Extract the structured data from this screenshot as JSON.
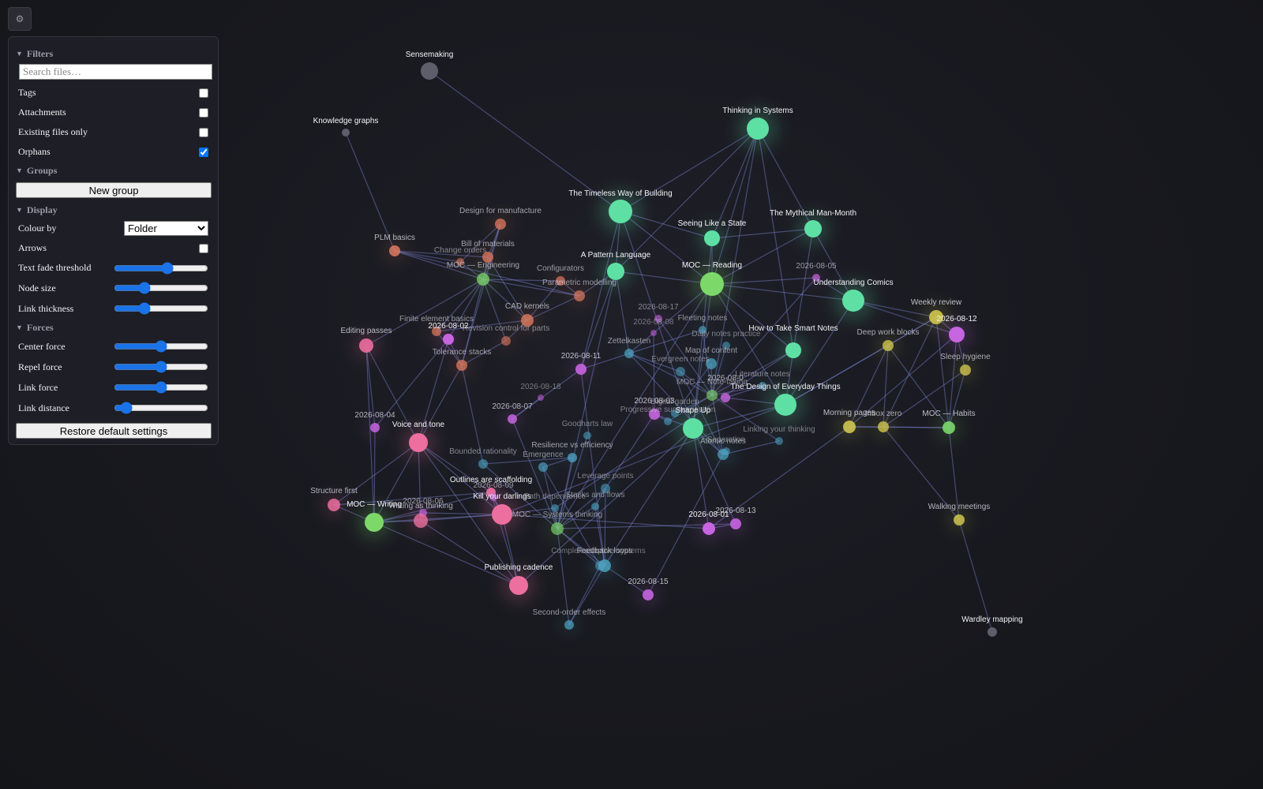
{
  "toolbar": {
    "settings_icon": "gear-icon",
    "settings_glyph": "⚙"
  },
  "settings": {
    "filters": {
      "title": "Filters",
      "search_placeholder": "Search files…",
      "search_value": "",
      "toggles": [
        {
          "label": "Tags",
          "checked": false
        },
        {
          "label": "Attachments",
          "checked": false
        },
        {
          "label": "Existing files only",
          "checked": false
        },
        {
          "label": "Orphans",
          "checked": true
        }
      ]
    },
    "groups": {
      "title": "Groups",
      "new_group_label": "New group"
    },
    "display": {
      "title": "Display",
      "colour_by_label": "Colour by",
      "colour_by_value": "Folder",
      "arrows_label": "Arrows",
      "arrows_checked": false,
      "sliders": [
        {
          "label": "Text fade threshold",
          "value": 0.58
        },
        {
          "label": "Node size",
          "value": 0.3
        },
        {
          "label": "Link thickness",
          "value": 0.3
        }
      ]
    },
    "forces": {
      "title": "Forces",
      "sliders": [
        {
          "label": "Center force",
          "value": 0.5
        },
        {
          "label": "Repel force",
          "value": 0.5
        },
        {
          "label": "Link force",
          "value": 0.5
        },
        {
          "label": "Link distance",
          "value": 0.08
        }
      ]
    },
    "restore_label": "Restore default settings"
  },
  "graph": {
    "colors": {
      "reading": "#5ee0a4",
      "moc": "#7dd86a",
      "writing": "#ec6f9f",
      "engineering": "#e07a5f",
      "daily": "#c765e0",
      "habits": "#cfc64e",
      "systems": "#4fa6c6",
      "unresolved": "#5d5e6a"
    },
    "nodes": [
      {
        "id": "sense",
        "label": "Sensemaking",
        "group": "unresolved"
      },
      {
        "id": "kg",
        "label": "Knowledge graphs",
        "group": "unresolved"
      },
      {
        "id": "tis",
        "label": "Thinking in Systems",
        "group": "reading"
      },
      {
        "id": "twb",
        "label": "The Timeless Way of Building",
        "group": "reading"
      },
      {
        "id": "sls",
        "label": "Seeing Like a State",
        "group": "reading"
      },
      {
        "id": "tmm",
        "label": "The Mythical Man-Month",
        "group": "reading"
      },
      {
        "id": "apl",
        "label": "A Pattern Language",
        "group": "reading"
      },
      {
        "id": "mocr",
        "label": "MOC — Reading",
        "group": "moc"
      },
      {
        "id": "uc",
        "label": "Understanding Comics",
        "group": "reading"
      },
      {
        "id": "htsn",
        "label": "How to Take Smart Notes",
        "group": "reading"
      },
      {
        "id": "tdet",
        "label": "The Design of Everyday Things",
        "group": "reading"
      },
      {
        "id": "su",
        "label": "Shape Up",
        "group": "reading"
      },
      {
        "id": "dfm",
        "label": "Design for manufacture",
        "group": "engineering"
      },
      {
        "id": "plm",
        "label": "PLM basics",
        "group": "engineering"
      },
      {
        "id": "bom",
        "label": "Bill of materials",
        "group": "engineering"
      },
      {
        "id": "co",
        "label": "Change orders",
        "group": "engineering"
      },
      {
        "id": "moce",
        "label": "MOC — Engineering",
        "group": "moc"
      },
      {
        "id": "conf",
        "label": "Configurators",
        "group": "engineering"
      },
      {
        "id": "pm",
        "label": "Parametric modelling",
        "group": "engineering"
      },
      {
        "id": "cad",
        "label": "CAD kernels",
        "group": "engineering"
      },
      {
        "id": "fea",
        "label": "Finite element basics",
        "group": "engineering"
      },
      {
        "id": "rcp",
        "label": "Revision control for parts",
        "group": "engineering"
      },
      {
        "id": "tol",
        "label": "Tolerance stacks",
        "group": "engineering"
      },
      {
        "id": "d0802",
        "label": "2026-08-02",
        "group": "daily"
      },
      {
        "id": "ep",
        "label": "Editing passes",
        "group": "writing"
      },
      {
        "id": "d0805",
        "label": "2026-08-05",
        "group": "daily"
      },
      {
        "id": "d0817",
        "label": "2026-08-17",
        "group": "daily"
      },
      {
        "id": "d0808",
        "label": "2026-08-08",
        "group": "daily"
      },
      {
        "id": "wr",
        "label": "Weekly review",
        "group": "habits"
      },
      {
        "id": "d0812",
        "label": "2026-08-12",
        "group": "daily"
      },
      {
        "id": "dwb",
        "label": "Deep work blocks",
        "group": "habits"
      },
      {
        "id": "sh",
        "label": "Sleep hygiene",
        "group": "habits"
      },
      {
        "id": "fn",
        "label": "Fleeting notes",
        "group": "systems"
      },
      {
        "id": "dnp",
        "label": "Daily notes practice",
        "group": "systems"
      },
      {
        "id": "zk",
        "label": "Zettelkasten",
        "group": "systems"
      },
      {
        "id": "mapc",
        "label": "Map of content",
        "group": "systems"
      },
      {
        "id": "en",
        "label": "Evergreen notes",
        "group": "systems"
      },
      {
        "id": "d0811",
        "label": "2026-08-11",
        "group": "daily"
      },
      {
        "id": "d0818",
        "label": "2026-08-18",
        "group": "daily"
      },
      {
        "id": "ln",
        "label": "Literature notes",
        "group": "systems"
      },
      {
        "id": "mocnt",
        "label": "MOC — Note-taking",
        "group": "moc"
      },
      {
        "id": "d0807b",
        "label": "2026-08-0",
        "group": "daily"
      },
      {
        "id": "dg",
        "label": "Digital garden",
        "group": "systems"
      },
      {
        "id": "d0803",
        "label": "2026-08-03",
        "group": "daily"
      },
      {
        "id": "ps",
        "label": "Progressive summarisation",
        "group": "systems"
      },
      {
        "id": "d0804",
        "label": "2026-08-04",
        "group": "daily"
      },
      {
        "id": "vt",
        "label": "Voice and tone",
        "group": "writing"
      },
      {
        "id": "d0807",
        "label": "2026-08-07",
        "group": "daily"
      },
      {
        "id": "gl",
        "label": "Goodharts law",
        "group": "systems"
      },
      {
        "id": "mp",
        "label": "Morning pages",
        "group": "habits"
      },
      {
        "id": "iz",
        "label": "Inbox zero",
        "group": "habits"
      },
      {
        "id": "moch",
        "label": "MOC — Habits",
        "group": "moc"
      },
      {
        "id": "sep",
        "label": "Separation",
        "group": "systems"
      },
      {
        "id": "an",
        "label": "Atomic notes",
        "group": "systems"
      },
      {
        "id": "lyt",
        "label": "Linking your thinking",
        "group": "systems"
      },
      {
        "id": "br",
        "label": "Bounded rationality",
        "group": "systems"
      },
      {
        "id": "rve",
        "label": "Resilience vs efficiency",
        "group": "systems"
      },
      {
        "id": "emg",
        "label": "Emergence",
        "group": "systems"
      },
      {
        "id": "lp",
        "label": "Leverage points",
        "group": "systems"
      },
      {
        "id": "sf",
        "label": "Structure first",
        "group": "writing"
      },
      {
        "id": "mocw",
        "label": "MOC — Writing",
        "group": "moc"
      },
      {
        "id": "d0806",
        "label": "2026-08-06",
        "group": "daily"
      },
      {
        "id": "wat",
        "label": "Writing as thinking",
        "group": "writing"
      },
      {
        "id": "oas",
        "label": "Outlines are scaffolding",
        "group": "writing"
      },
      {
        "id": "d0809",
        "label": "2026-08-09",
        "group": "daily"
      },
      {
        "id": "kyd",
        "label": "Kill your darlings",
        "group": "writing"
      },
      {
        "id": "pd",
        "label": "Path dependence",
        "group": "systems"
      },
      {
        "id": "saf",
        "label": "Stocks and flows",
        "group": "systems"
      },
      {
        "id": "mocst",
        "label": "MOC — Systems thinking",
        "group": "moc"
      },
      {
        "id": "d0801",
        "label": "2026-08-01",
        "group": "daily"
      },
      {
        "id": "d0813",
        "label": "2026-08-13",
        "group": "daily"
      },
      {
        "id": "wm",
        "label": "Walking meetings",
        "group": "habits"
      },
      {
        "id": "cas",
        "label": "Complex adaptive systems",
        "group": "systems"
      },
      {
        "id": "fl",
        "label": "Feedback loops",
        "group": "systems"
      },
      {
        "id": "pc",
        "label": "Publishing cadence",
        "group": "writing"
      },
      {
        "id": "d0815",
        "label": "2026-08-15",
        "group": "daily"
      },
      {
        "id": "soe",
        "label": "Second-order effects",
        "group": "systems"
      },
      {
        "id": "ward",
        "label": "Wardley mapping",
        "group": "unresolved"
      }
    ],
    "links": [
      [
        "sense",
        "twb"
      ],
      [
        "kg",
        "plm"
      ],
      [
        "tis",
        "twb"
      ],
      [
        "tis",
        "tmm"
      ],
      [
        "tis",
        "sls"
      ],
      [
        "tis",
        "apl"
      ],
      [
        "tis",
        "htsn"
      ],
      [
        "tis",
        "mocr"
      ],
      [
        "twb",
        "apl"
      ],
      [
        "twb",
        "mocr"
      ],
      [
        "twb",
        "sls"
      ],
      [
        "twb",
        "su"
      ],
      [
        "sls",
        "tmm"
      ],
      [
        "sls",
        "mocr"
      ],
      [
        "tmm",
        "uc"
      ],
      [
        "tmm",
        "mocr"
      ],
      [
        "tmm",
        "htsn"
      ],
      [
        "mocr",
        "uc"
      ],
      [
        "mocr",
        "htsn"
      ],
      [
        "mocr",
        "tdet"
      ],
      [
        "mocr",
        "su"
      ],
      [
        "mocr",
        "apl"
      ],
      [
        "mocr",
        "zk"
      ],
      [
        "mocr",
        "d0805"
      ],
      [
        "uc",
        "d0812"
      ],
      [
        "uc",
        "wr"
      ],
      [
        "uc",
        "tdet"
      ],
      [
        "htsn",
        "mocnt"
      ],
      [
        "htsn",
        "tdet"
      ],
      [
        "tdet",
        "su"
      ],
      [
        "tdet",
        "d0807b"
      ],
      [
        "tdet",
        "dwb"
      ],
      [
        "su",
        "d0803"
      ],
      [
        "su",
        "an"
      ],
      [
        "su",
        "d0801"
      ],
      [
        "su",
        "d0813"
      ],
      [
        "apl",
        "zk"
      ],
      [
        "apl",
        "d0811"
      ],
      [
        "apl",
        "pm"
      ],
      [
        "dfm",
        "moce"
      ],
      [
        "dfm",
        "bom"
      ],
      [
        "dfm",
        "co"
      ],
      [
        "plm",
        "moce"
      ],
      [
        "plm",
        "bom"
      ],
      [
        "plm",
        "co"
      ],
      [
        "plm",
        "pm"
      ],
      [
        "bom",
        "moce"
      ],
      [
        "co",
        "moce"
      ],
      [
        "moce",
        "conf"
      ],
      [
        "moce",
        "pm"
      ],
      [
        "moce",
        "cad"
      ],
      [
        "moce",
        "fea"
      ],
      [
        "moce",
        "rcp"
      ],
      [
        "moce",
        "tol"
      ],
      [
        "moce",
        "d0802"
      ],
      [
        "moce",
        "ep"
      ],
      [
        "conf",
        "pm"
      ],
      [
        "conf",
        "cad"
      ],
      [
        "pm",
        "cad"
      ],
      [
        "cad",
        "fea"
      ],
      [
        "cad",
        "rcp"
      ],
      [
        "rcp",
        "tol"
      ],
      [
        "fea",
        "tol"
      ],
      [
        "tol",
        "d0802"
      ],
      [
        "tol",
        "br"
      ],
      [
        "tol",
        "vt"
      ],
      [
        "dfm",
        "tol"
      ],
      [
        "bom",
        "cad"
      ],
      [
        "ep",
        "mocw"
      ],
      [
        "ep",
        "d0804"
      ],
      [
        "ep",
        "vt"
      ],
      [
        "vt",
        "mocw"
      ],
      [
        "vt",
        "kyd"
      ],
      [
        "vt",
        "oas"
      ],
      [
        "vt",
        "wat"
      ],
      [
        "vt",
        "pc"
      ],
      [
        "vt",
        "d0802"
      ],
      [
        "sf",
        "mocw"
      ],
      [
        "sf",
        "oas"
      ],
      [
        "sf",
        "vt"
      ],
      [
        "mocw",
        "wat"
      ],
      [
        "mocw",
        "kyd"
      ],
      [
        "mocw",
        "oas"
      ],
      [
        "mocw",
        "pc"
      ],
      [
        "mocw",
        "d0804"
      ],
      [
        "mocw",
        "d0806"
      ],
      [
        "wat",
        "kyd"
      ],
      [
        "oas",
        "kyd"
      ],
      [
        "kyd",
        "pc"
      ],
      [
        "kyd",
        "d0809"
      ],
      [
        "oas",
        "pc"
      ],
      [
        "wat",
        "pc"
      ],
      [
        "d0806",
        "kyd"
      ],
      [
        "d0804",
        "d0802"
      ],
      [
        "mocst",
        "emg"
      ],
      [
        "mocst",
        "rve"
      ],
      [
        "mocst",
        "lp"
      ],
      [
        "mocst",
        "saf"
      ],
      [
        "mocst",
        "pd"
      ],
      [
        "mocst",
        "fl"
      ],
      [
        "mocst",
        "cas"
      ],
      [
        "mocst",
        "br"
      ],
      [
        "mocst",
        "gl"
      ],
      [
        "mocst",
        "soe"
      ],
      [
        "fl",
        "cas"
      ],
      [
        "fl",
        "saf"
      ],
      [
        "fl",
        "lp"
      ],
      [
        "fl",
        "soe"
      ],
      [
        "fl",
        "d0815"
      ],
      [
        "saf",
        "lp"
      ],
      [
        "emg",
        "rve"
      ],
      [
        "emg",
        "cas"
      ],
      [
        "rve",
        "br"
      ],
      [
        "pd",
        "kyd"
      ],
      [
        "soe",
        "cas"
      ],
      [
        "mocnt",
        "zk"
      ],
      [
        "mocnt",
        "fn"
      ],
      [
        "mocnt",
        "ln"
      ],
      [
        "mocnt",
        "en"
      ],
      [
        "mocnt",
        "mapc"
      ],
      [
        "mocnt",
        "dg"
      ],
      [
        "mocnt",
        "ps"
      ],
      [
        "mocnt",
        "an"
      ],
      [
        "mocnt",
        "lyt"
      ],
      [
        "mocnt",
        "dnp"
      ],
      [
        "zk",
        "fn"
      ],
      [
        "zk",
        "en"
      ],
      [
        "zk",
        "d0811"
      ],
      [
        "zk",
        "an"
      ],
      [
        "en",
        "an"
      ],
      [
        "ln",
        "d0807b"
      ],
      [
        "mapc",
        "dg"
      ],
      [
        "ps",
        "d0803"
      ],
      [
        "an",
        "sep"
      ],
      [
        "an",
        "lyt"
      ],
      [
        "wr",
        "moch"
      ],
      [
        "wr",
        "d0812"
      ],
      [
        "wr",
        "dwb"
      ],
      [
        "wr",
        "iz"
      ],
      [
        "d0812",
        "moch"
      ],
      [
        "d0812",
        "sh"
      ],
      [
        "dwb",
        "moch"
      ],
      [
        "dwb",
        "mp"
      ],
      [
        "dwb",
        "iz"
      ],
      [
        "sh",
        "moch"
      ],
      [
        "sh",
        "iz"
      ],
      [
        "mp",
        "iz"
      ],
      [
        "iz",
        "moch"
      ],
      [
        "mp",
        "moch"
      ],
      [
        "moch",
        "wm"
      ],
      [
        "wm",
        "ward"
      ],
      [
        "iz",
        "wm"
      ],
      [
        "mp",
        "d0801"
      ],
      [
        "d0812",
        "mp"
      ],
      [
        "d0801",
        "d0813"
      ],
      [
        "d0801",
        "kyd"
      ],
      [
        "d0813",
        "mocst"
      ],
      [
        "d0815",
        "an"
      ],
      [
        "d0818",
        "d0807"
      ],
      [
        "d0807",
        "mocst"
      ],
      [
        "d0807",
        "d0811"
      ],
      [
        "d0811",
        "fl"
      ],
      [
        "d0817",
        "mocnt"
      ],
      [
        "d0808",
        "d0803"
      ],
      [
        "d0803",
        "lp"
      ],
      [
        "d0805",
        "mocnt"
      ],
      [
        "d0805",
        "uc"
      ],
      [
        "mocr",
        "mocst"
      ],
      [
        "su",
        "fl"
      ],
      [
        "tdet",
        "kyd"
      ],
      [
        "twb",
        "d0811"
      ],
      [
        "tdet",
        "wr"
      ],
      [
        "sls",
        "su"
      ],
      [
        "tis",
        "mocnt"
      ],
      [
        "htsn",
        "pd"
      ],
      [
        "apl",
        "mocst"
      ],
      [
        "su",
        "pc"
      ]
    ]
  }
}
